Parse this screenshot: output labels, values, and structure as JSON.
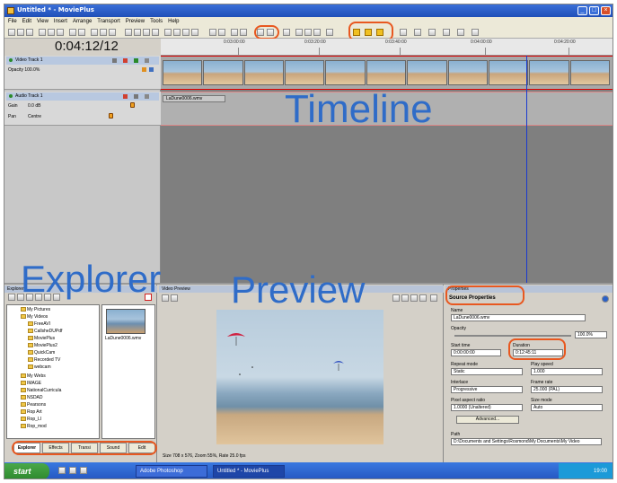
{
  "window": {
    "title": "Untitled * - MoviePlus"
  },
  "menu": [
    "File",
    "Edit",
    "View",
    "Insert",
    "Arrange",
    "Transport",
    "Preview",
    "Tools",
    "Help"
  ],
  "timecode": "0:04:12/12",
  "ruler": [
    "0:03:00:00",
    "0:03:20:00",
    "0:03:40:00",
    "0:04:00:00",
    "0:04:20:00"
  ],
  "tracks": {
    "video": {
      "name": "Video Track 1",
      "prop_label": "Opacity 100.0%"
    },
    "audio": {
      "name": "Audio Track 1",
      "gain_label": "Gain",
      "gain_value": "0.0 dB",
      "pan_label": "Pan",
      "pan_value": "Centre",
      "clip_name": "LaDune0006.wmv"
    }
  },
  "labels": {
    "timeline": "Timeline",
    "explorer": "Explorer",
    "preview": "Preview"
  },
  "explorer": {
    "header": "Explorer",
    "tree": [
      "My Pictures",
      "My Videos",
      "FreeAVI",
      "CallsheDUPdf",
      "MoviePlus",
      "MoviePlus2",
      "QuickCam",
      "Recorded TV",
      "webcam",
      "My Webs",
      "IMAGE",
      "NationalCurricula",
      "NSDAD",
      "Pearsons",
      "Rop Art",
      "Rop_LI",
      "Rop_mod"
    ],
    "file_name": "LaDune0006.wmv",
    "tabs": [
      "Explorer",
      "Effects",
      "Transi",
      "Sound",
      "Edit"
    ]
  },
  "preview": {
    "header": "Video Preview",
    "status": "Size 708 x 576, Zoom 55%, Rate 25.0 fps"
  },
  "properties": {
    "header": "Properties",
    "section": "Source Properties",
    "name_label": "Name",
    "name_value": "LaDune0006.wmv",
    "opacity_label": "Opacity",
    "opacity_value": "100.0%",
    "start_label": "Start time",
    "start_value": "0:00:00:00",
    "duration_label": "Duration",
    "duration_value": "0:12:45:11",
    "repeat_label": "Repeat mode",
    "repeat_value": "Static",
    "play_speed_label": "Play speed",
    "play_speed_value": "1.000",
    "interlace_label": "Interlace",
    "interlace_value": "Progressive",
    "frame_rate_label": "Frame rate",
    "frame_rate_value": "25.000 (PAL)",
    "aspect_label": "Pixel aspect ratio",
    "aspect_value": "1.0000 (Unaltered)",
    "size_mode_label": "Size mode",
    "size_mode_value": "Auto",
    "advanced_label": "Advanced...",
    "path_label": "Path",
    "path_value": "D:\\Documents and Settings\\Rosmond\\My Documents\\My Video"
  },
  "taskbar": {
    "start": "start",
    "tasks": [
      "Adobe Photoshop",
      "Untitled * - MoviePlus"
    ],
    "clock": "19:00"
  }
}
